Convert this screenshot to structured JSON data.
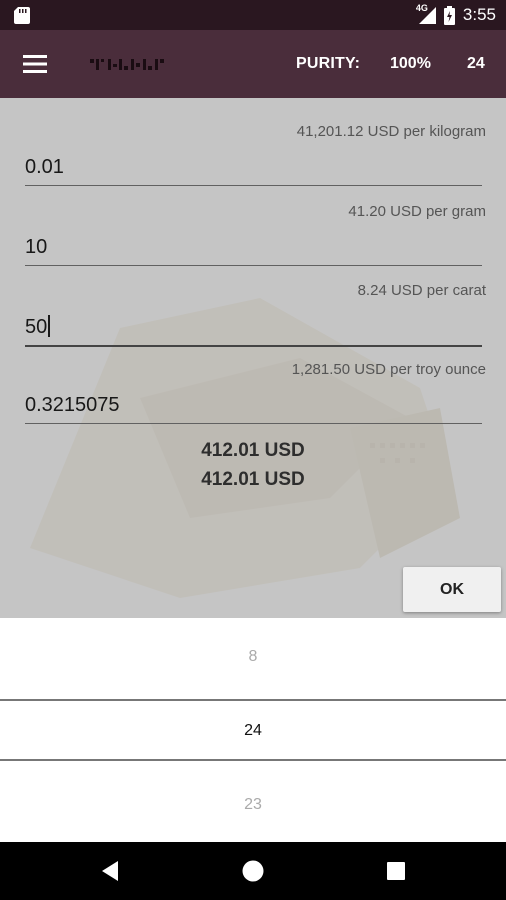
{
  "status_bar": {
    "network": "4G",
    "time": "3:55",
    "icons": [
      "sd-card-icon",
      "signal-icon",
      "battery-icon"
    ]
  },
  "app_bar": {
    "purity_label": "PURITY:",
    "purity_value": "100%",
    "karat": "24",
    "icons": [
      "menu-icon",
      "app-logo"
    ]
  },
  "fields": [
    {
      "rate": "41,201.12 USD per kilogram",
      "value": "0.01"
    },
    {
      "rate": "41.20 USD per gram",
      "value": "10"
    },
    {
      "rate": "8.24 USD per carat",
      "value": "50"
    },
    {
      "rate": "1,281.50 USD per troy ounce",
      "value": "0.3215075"
    }
  ],
  "totals": [
    "412.01 USD",
    "412.01 USD"
  ],
  "ok_label": "OK",
  "picker": {
    "above": "8",
    "selected": "24",
    "below": "23"
  },
  "nav_bar": {
    "icons": [
      "back-icon",
      "home-icon",
      "recents-icon"
    ]
  }
}
